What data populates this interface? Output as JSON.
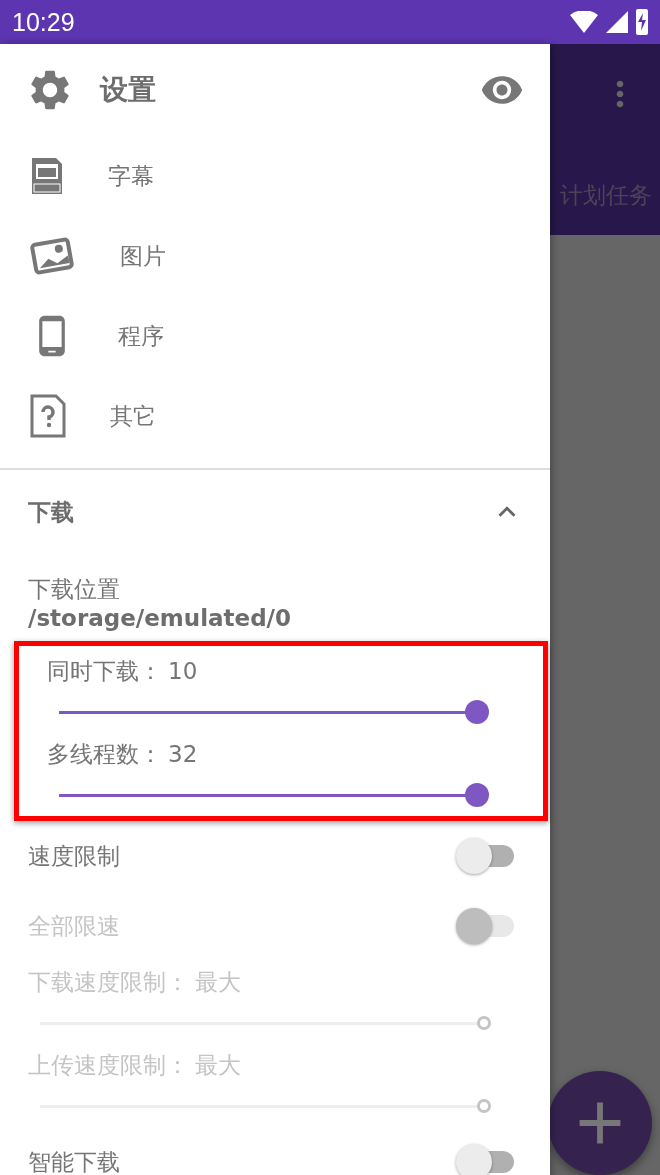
{
  "status_bar": {
    "time": "10:29"
  },
  "background": {
    "tab_label": "计划任务"
  },
  "drawer": {
    "title": "设置",
    "items": [
      {
        "label": "字幕",
        "kind": "subtitle"
      },
      {
        "label": "图片",
        "kind": "image"
      },
      {
        "label": "程序",
        "kind": "app"
      },
      {
        "label": "其它",
        "kind": "other"
      }
    ],
    "section": {
      "title": "下载",
      "expanded": true,
      "settings": [
        {
          "kind": "info",
          "label": "下载位置",
          "value": "/storage/emulated/0"
        },
        {
          "kind": "slider",
          "label": "同时下载：",
          "value": "10",
          "level": 1,
          "disabled": false,
          "highlighted": true
        },
        {
          "kind": "slider",
          "label": "多线程数：",
          "value": "32",
          "level": 1,
          "disabled": false,
          "highlighted": true
        },
        {
          "kind": "switch",
          "label": "速度限制",
          "on": false,
          "disabled": false
        },
        {
          "kind": "switch",
          "label": "全部限速",
          "on": false,
          "disabled": true
        },
        {
          "kind": "slider",
          "label": "下载速度限制：",
          "value": "最大",
          "level": 1,
          "disabled": true,
          "highlighted": false
        },
        {
          "kind": "slider",
          "label": "上传速度限制：",
          "value": "最大",
          "level": 1,
          "disabled": true,
          "highlighted": false
        },
        {
          "kind": "switch",
          "label": "智能下载",
          "on": false,
          "disabled": false
        }
      ]
    }
  }
}
